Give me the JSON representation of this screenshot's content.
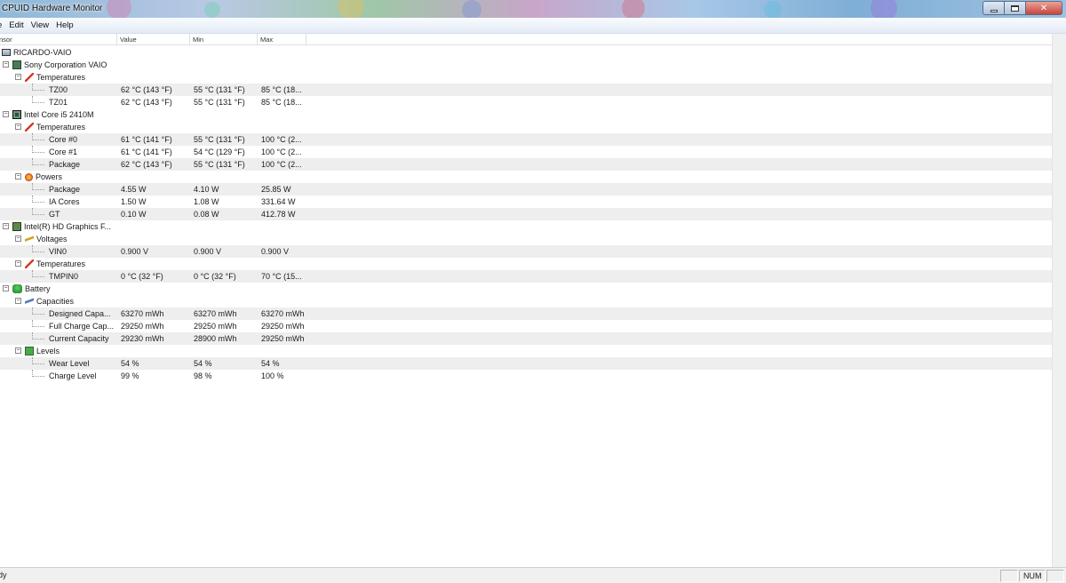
{
  "window": {
    "title": "CPUID Hardware Monitor",
    "controls": {
      "minimize": "minimize",
      "maximize": "maximize",
      "close": "close"
    }
  },
  "menu": [
    "e",
    "Edit",
    "View",
    "Help"
  ],
  "columns": {
    "sensor": "nsor",
    "value": "Value",
    "min": "Min",
    "max": "Max"
  },
  "tree": [
    {
      "level": 0,
      "icon": "computer-icon",
      "name": "RICARDO-VAIO",
      "value": "",
      "min": "",
      "max": "",
      "expander": "",
      "shaded": false
    },
    {
      "level": 1,
      "icon": "board-icon",
      "name": "Sony Corporation VAIO",
      "value": "",
      "min": "",
      "max": "",
      "expander": "⊟",
      "shaded": false
    },
    {
      "level": 2,
      "icon": "thermo-icon",
      "name": "Temperatures",
      "value": "",
      "min": "",
      "max": "",
      "expander": "⊟",
      "shaded": false
    },
    {
      "level": 3,
      "icon": "",
      "name": "TZ00",
      "value": "62 °C  (143 °F)",
      "min": "55 °C  (131 °F)",
      "max": "85 °C  (18...",
      "expander": "",
      "shaded": true
    },
    {
      "level": 3,
      "icon": "",
      "name": "TZ01",
      "value": "62 °C  (143 °F)",
      "min": "55 °C  (131 °F)",
      "max": "85 °C  (18...",
      "expander": "",
      "shaded": false
    },
    {
      "level": 1,
      "icon": "cpu-icon",
      "name": "Intel Core i5 2410M",
      "value": "",
      "min": "",
      "max": "",
      "expander": "⊟",
      "shaded": false
    },
    {
      "level": 2,
      "icon": "thermo-icon",
      "name": "Temperatures",
      "value": "",
      "min": "",
      "max": "",
      "expander": "⊟",
      "shaded": false
    },
    {
      "level": 3,
      "icon": "",
      "name": "Core #0",
      "value": "61 °C  (141 °F)",
      "min": "55 °C  (131 °F)",
      "max": "100 °C  (2...",
      "expander": "",
      "shaded": true
    },
    {
      "level": 3,
      "icon": "",
      "name": "Core #1",
      "value": "61 °C  (141 °F)",
      "min": "54 °C  (129 °F)",
      "max": "100 °C  (2...",
      "expander": "",
      "shaded": false
    },
    {
      "level": 3,
      "icon": "",
      "name": "Package",
      "value": "62 °C  (143 °F)",
      "min": "55 °C  (131 °F)",
      "max": "100 °C  (2...",
      "expander": "",
      "shaded": true
    },
    {
      "level": 2,
      "icon": "power-icon",
      "name": "Powers",
      "value": "",
      "min": "",
      "max": "",
      "expander": "⊟",
      "shaded": false
    },
    {
      "level": 3,
      "icon": "",
      "name": "Package",
      "value": "4.55 W",
      "min": "4.10 W",
      "max": "25.85 W",
      "expander": "",
      "shaded": true
    },
    {
      "level": 3,
      "icon": "",
      "name": "IA Cores",
      "value": "1.50 W",
      "min": "1.08 W",
      "max": "331.64 W",
      "expander": "",
      "shaded": false
    },
    {
      "level": 3,
      "icon": "",
      "name": "GT",
      "value": "0.10 W",
      "min": "0.08 W",
      "max": "412.78 W",
      "expander": "",
      "shaded": true
    },
    {
      "level": 1,
      "icon": "gpu-icon",
      "name": "Intel(R) HD Graphics F...",
      "value": "",
      "min": "",
      "max": "",
      "expander": "⊟",
      "shaded": false
    },
    {
      "level": 2,
      "icon": "volt-icon",
      "name": "Voltages",
      "value": "",
      "min": "",
      "max": "",
      "expander": "⊟",
      "shaded": false
    },
    {
      "level": 3,
      "icon": "",
      "name": "VIN0",
      "value": "0.900 V",
      "min": "0.900 V",
      "max": "0.900 V",
      "expander": "",
      "shaded": true
    },
    {
      "level": 2,
      "icon": "thermo-icon",
      "name": "Temperatures",
      "value": "",
      "min": "",
      "max": "",
      "expander": "⊟",
      "shaded": false
    },
    {
      "level": 3,
      "icon": "",
      "name": "TMPIN0",
      "value": "0 °C  (32 °F)",
      "min": "0 °C  (32 °F)",
      "max": "70 °C  (15...",
      "expander": "",
      "shaded": true
    },
    {
      "level": 1,
      "icon": "battery-icon",
      "name": "Battery",
      "value": "",
      "min": "",
      "max": "",
      "expander": "⊟",
      "shaded": false
    },
    {
      "level": 2,
      "icon": "cap-icon",
      "name": "Capacities",
      "value": "",
      "min": "",
      "max": "",
      "expander": "⊟",
      "shaded": false
    },
    {
      "level": 3,
      "icon": "",
      "name": "Designed Capa...",
      "value": "63270 mWh",
      "min": "63270 mWh",
      "max": "63270 mWh",
      "expander": "",
      "shaded": true
    },
    {
      "level": 3,
      "icon": "",
      "name": "Full Charge Cap...",
      "value": "29250 mWh",
      "min": "29250 mWh",
      "max": "29250 mWh",
      "expander": "",
      "shaded": false
    },
    {
      "level": 3,
      "icon": "",
      "name": "Current Capacity",
      "value": "29230 mWh",
      "min": "28900 mWh",
      "max": "29250 mWh",
      "expander": "",
      "shaded": true
    },
    {
      "level": 2,
      "icon": "level-icon",
      "name": "Levels",
      "value": "",
      "min": "",
      "max": "",
      "expander": "⊟",
      "shaded": false
    },
    {
      "level": 3,
      "icon": "",
      "name": "Wear Level",
      "value": "54 %",
      "min": "54 %",
      "max": "54 %",
      "expander": "",
      "shaded": true
    },
    {
      "level": 3,
      "icon": "",
      "name": "Charge Level",
      "value": "99 %",
      "min": "98 %",
      "max": "100 %",
      "expander": "",
      "shaded": false
    }
  ],
  "status": {
    "text": "dy",
    "num": "NUM"
  }
}
